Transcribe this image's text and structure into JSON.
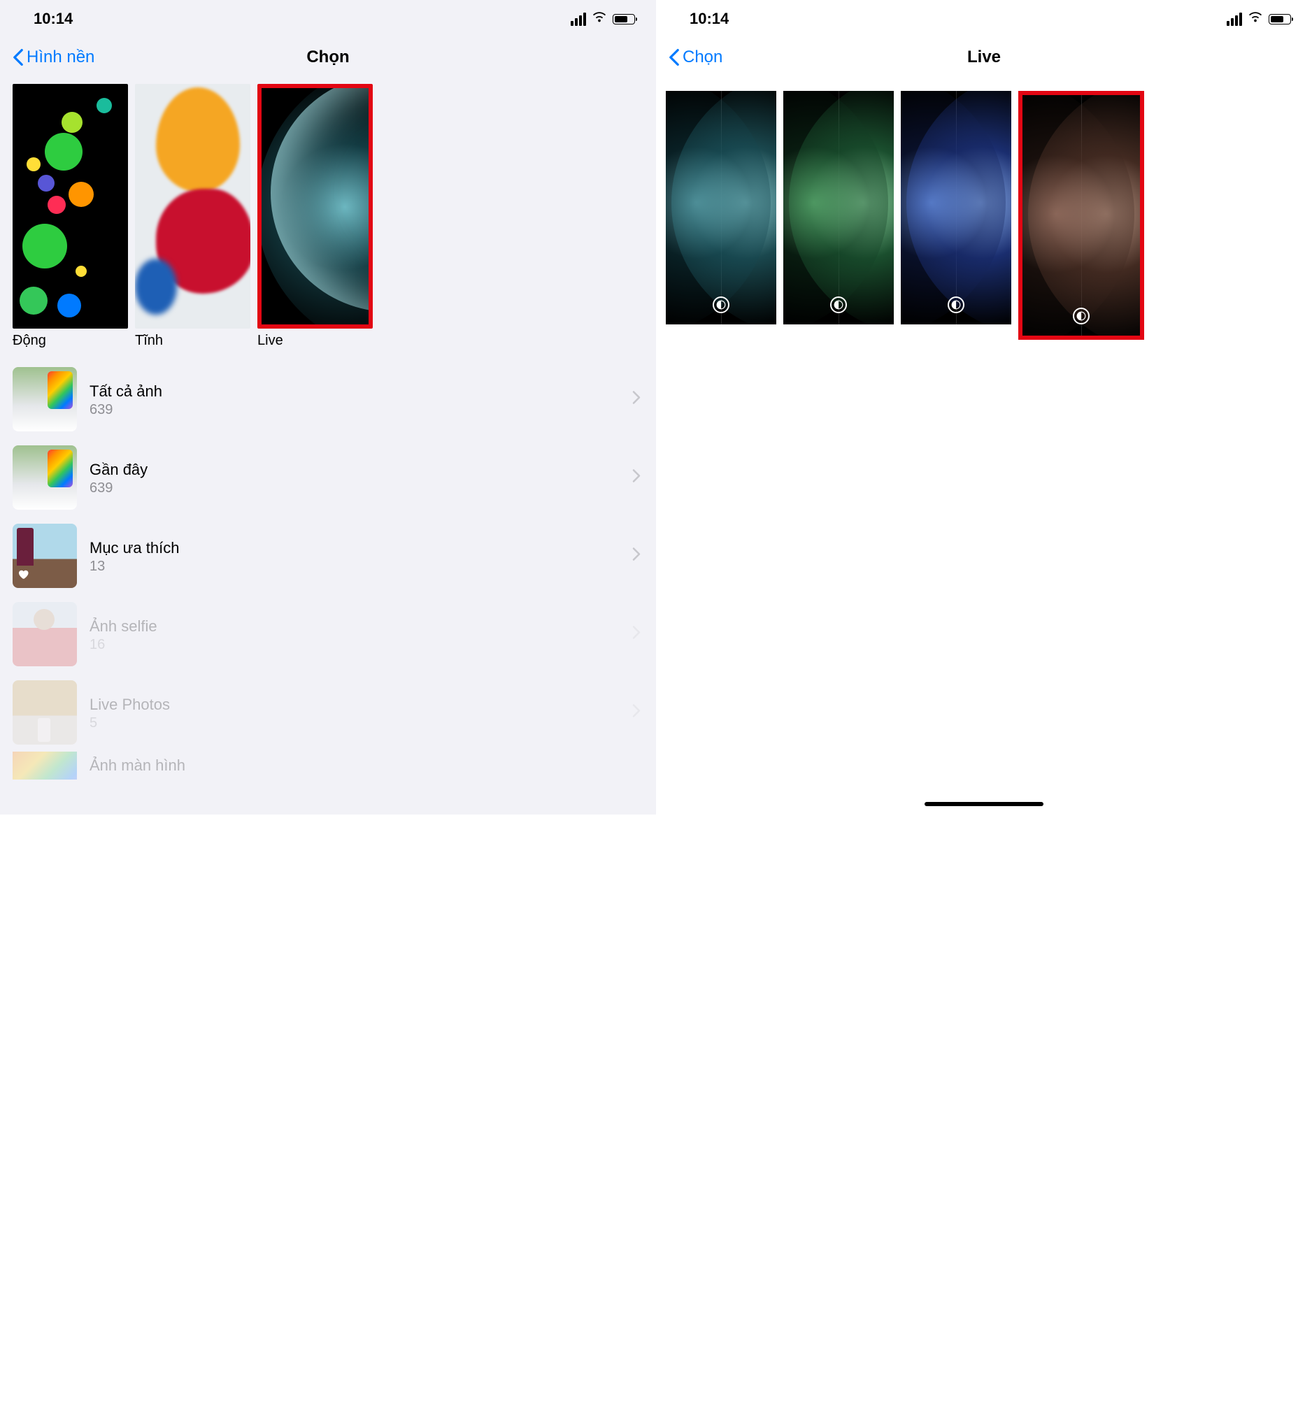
{
  "left": {
    "status_time": "10:14",
    "back_label": "Hình nền",
    "title": "Chọn",
    "categories": [
      {
        "id": "dong",
        "label": "Động",
        "highlight": false
      },
      {
        "id": "tinh",
        "label": "Tĩnh",
        "highlight": false
      },
      {
        "id": "live",
        "label": "Live",
        "highlight": true
      }
    ],
    "albums": [
      {
        "id": "all",
        "title": "Tất cả ảnh",
        "count": "639",
        "faded": false,
        "heart": false
      },
      {
        "id": "recent",
        "title": "Gần đây",
        "count": "639",
        "faded": false,
        "heart": false
      },
      {
        "id": "favorites",
        "title": "Mục ưa thích",
        "count": "13",
        "faded": false,
        "heart": true
      },
      {
        "id": "selfie",
        "title": "Ảnh selfie",
        "count": "16",
        "faded": true,
        "heart": false
      },
      {
        "id": "livephotos",
        "title": "Live Photos",
        "count": "5",
        "faded": true,
        "heart": false
      },
      {
        "id": "screenshot",
        "title": "Ảnh màn hình",
        "count": "",
        "faded": true,
        "heart": false
      }
    ]
  },
  "right": {
    "status_time": "10:14",
    "back_label": "Chọn",
    "title": "Live",
    "items": [
      {
        "id": "teal",
        "variant": "teal",
        "dark_mode_icon": true,
        "highlight": false
      },
      {
        "id": "green",
        "variant": "green",
        "dark_mode_icon": true,
        "highlight": false
      },
      {
        "id": "blue",
        "variant": "blue",
        "dark_mode_icon": true,
        "highlight": false
      },
      {
        "id": "copper",
        "variant": "copper",
        "dark_mode_icon": true,
        "highlight": true
      }
    ]
  }
}
